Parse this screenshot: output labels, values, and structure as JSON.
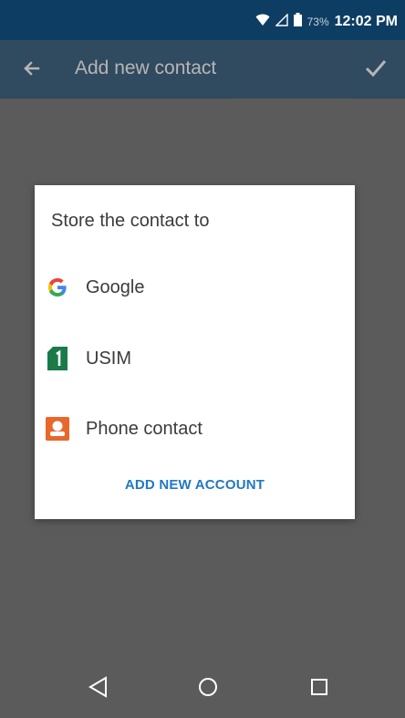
{
  "status_bar": {
    "battery_percent": "73%",
    "time": "12:02 PM",
    "icons": [
      "wifi-icon",
      "signal-icon",
      "battery-icon"
    ]
  },
  "app_bar": {
    "title": "Add new contact",
    "back_icon": "back-arrow-icon",
    "confirm_icon": "checkmark-icon"
  },
  "dialog": {
    "title": "Store the contact to",
    "options": [
      {
        "label": "Google",
        "icon": "google-icon"
      },
      {
        "label": "USIM",
        "icon": "usim-icon"
      },
      {
        "label": "Phone contact",
        "icon": "phone-contact-icon"
      }
    ],
    "action_label": "ADD NEW ACCOUNT"
  },
  "nav_bar": {
    "buttons": [
      "back",
      "home",
      "recents"
    ]
  },
  "colors": {
    "app_bar": "#0e3d63",
    "scrim": "#5b5b5b",
    "accent": "#1f79c7",
    "usim_green": "#1a7a4a",
    "phone_orange": "#e8672a"
  }
}
